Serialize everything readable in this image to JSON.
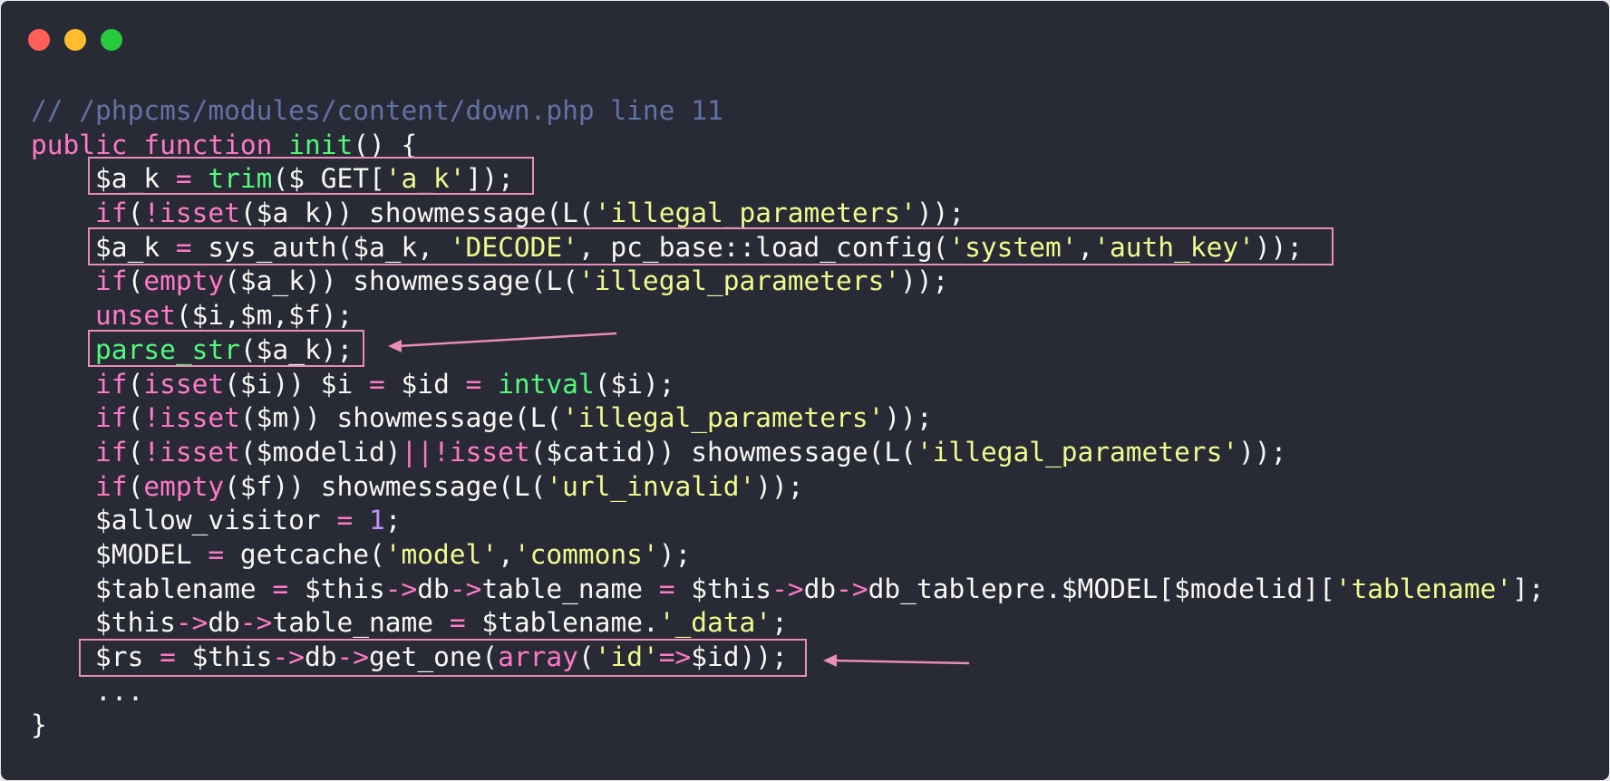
{
  "window": {
    "controls": [
      {
        "name": "close",
        "color": "#ff5f56"
      },
      {
        "name": "minimize",
        "color": "#ffbd2e"
      },
      {
        "name": "maximize",
        "color": "#27c93f"
      }
    ]
  },
  "highlight_color": "#e88db5",
  "code": {
    "lines": [
      [
        {
          "t": "// /phpcms/modules/content/down.php line 11",
          "c": "comment"
        }
      ],
      [
        {
          "t": "public",
          "c": "keyword"
        },
        {
          "t": " ",
          "c": "plain"
        },
        {
          "t": "function",
          "c": "keyword"
        },
        {
          "t": " ",
          "c": "plain"
        },
        {
          "t": "init",
          "c": "function"
        },
        {
          "t": "() {",
          "c": "plain"
        }
      ],
      [
        {
          "t": "    $a_k ",
          "c": "plain"
        },
        {
          "t": "=",
          "c": "operator"
        },
        {
          "t": " ",
          "c": "plain"
        },
        {
          "t": "trim",
          "c": "function"
        },
        {
          "t": "($_GET[",
          "c": "plain"
        },
        {
          "t": "'a_k'",
          "c": "string"
        },
        {
          "t": "]);",
          "c": "plain"
        }
      ],
      [
        {
          "t": "    ",
          "c": "plain"
        },
        {
          "t": "if",
          "c": "keyword"
        },
        {
          "t": "(",
          "c": "plain"
        },
        {
          "t": "!",
          "c": "operator"
        },
        {
          "t": "isset",
          "c": "keyword"
        },
        {
          "t": "($a_k)) showmessage(L(",
          "c": "plain"
        },
        {
          "t": "'illegal_parameters'",
          "c": "string"
        },
        {
          "t": "));",
          "c": "plain"
        }
      ],
      [
        {
          "t": "    $a_k ",
          "c": "plain"
        },
        {
          "t": "=",
          "c": "operator"
        },
        {
          "t": " sys_auth($a_k, ",
          "c": "plain"
        },
        {
          "t": "'DECODE'",
          "c": "string"
        },
        {
          "t": ", pc_base::load_config(",
          "c": "plain"
        },
        {
          "t": "'system'",
          "c": "string"
        },
        {
          "t": ",",
          "c": "plain"
        },
        {
          "t": "'auth_key'",
          "c": "string"
        },
        {
          "t": "));",
          "c": "plain"
        }
      ],
      [
        {
          "t": "    ",
          "c": "plain"
        },
        {
          "t": "if",
          "c": "keyword"
        },
        {
          "t": "(",
          "c": "plain"
        },
        {
          "t": "empty",
          "c": "keyword"
        },
        {
          "t": "($a_k)) showmessage(L(",
          "c": "plain"
        },
        {
          "t": "'illegal_parameters'",
          "c": "string"
        },
        {
          "t": "));",
          "c": "plain"
        }
      ],
      [
        {
          "t": "    ",
          "c": "plain"
        },
        {
          "t": "unset",
          "c": "keyword"
        },
        {
          "t": "($i,$m,$f);",
          "c": "plain"
        }
      ],
      [
        {
          "t": "    ",
          "c": "plain"
        },
        {
          "t": "parse_str",
          "c": "function"
        },
        {
          "t": "($a_k);",
          "c": "plain"
        }
      ],
      [
        {
          "t": "    ",
          "c": "plain"
        },
        {
          "t": "if",
          "c": "keyword"
        },
        {
          "t": "(",
          "c": "plain"
        },
        {
          "t": "isset",
          "c": "keyword"
        },
        {
          "t": "($i)) $i ",
          "c": "plain"
        },
        {
          "t": "=",
          "c": "operator"
        },
        {
          "t": " $id ",
          "c": "plain"
        },
        {
          "t": "=",
          "c": "operator"
        },
        {
          "t": " ",
          "c": "plain"
        },
        {
          "t": "intval",
          "c": "function"
        },
        {
          "t": "($i);",
          "c": "plain"
        }
      ],
      [
        {
          "t": "    ",
          "c": "plain"
        },
        {
          "t": "if",
          "c": "keyword"
        },
        {
          "t": "(",
          "c": "plain"
        },
        {
          "t": "!",
          "c": "operator"
        },
        {
          "t": "isset",
          "c": "keyword"
        },
        {
          "t": "($m)) showmessage(L(",
          "c": "plain"
        },
        {
          "t": "'illegal_parameters'",
          "c": "string"
        },
        {
          "t": "));",
          "c": "plain"
        }
      ],
      [
        {
          "t": "    ",
          "c": "plain"
        },
        {
          "t": "if",
          "c": "keyword"
        },
        {
          "t": "(",
          "c": "plain"
        },
        {
          "t": "!",
          "c": "operator"
        },
        {
          "t": "isset",
          "c": "keyword"
        },
        {
          "t": "($modelid)",
          "c": "plain"
        },
        {
          "t": "||!",
          "c": "operator"
        },
        {
          "t": "isset",
          "c": "keyword"
        },
        {
          "t": "($catid)) showmessage(L(",
          "c": "plain"
        },
        {
          "t": "'illegal_parameters'",
          "c": "string"
        },
        {
          "t": "));",
          "c": "plain"
        }
      ],
      [
        {
          "t": "    ",
          "c": "plain"
        },
        {
          "t": "if",
          "c": "keyword"
        },
        {
          "t": "(",
          "c": "plain"
        },
        {
          "t": "empty",
          "c": "keyword"
        },
        {
          "t": "($f)) showmessage(L(",
          "c": "plain"
        },
        {
          "t": "'url_invalid'",
          "c": "string"
        },
        {
          "t": "));",
          "c": "plain"
        }
      ],
      [
        {
          "t": "    $allow_visitor ",
          "c": "plain"
        },
        {
          "t": "=",
          "c": "operator"
        },
        {
          "t": " ",
          "c": "plain"
        },
        {
          "t": "1",
          "c": "number"
        },
        {
          "t": ";",
          "c": "plain"
        }
      ],
      [
        {
          "t": "    $MODEL ",
          "c": "plain"
        },
        {
          "t": "=",
          "c": "operator"
        },
        {
          "t": " getcache(",
          "c": "plain"
        },
        {
          "t": "'model'",
          "c": "string"
        },
        {
          "t": ",",
          "c": "plain"
        },
        {
          "t": "'commons'",
          "c": "string"
        },
        {
          "t": ");",
          "c": "plain"
        }
      ],
      [
        {
          "t": "    $tablename ",
          "c": "plain"
        },
        {
          "t": "=",
          "c": "operator"
        },
        {
          "t": " $this",
          "c": "plain"
        },
        {
          "t": "->",
          "c": "operator"
        },
        {
          "t": "db",
          "c": "plain"
        },
        {
          "t": "->",
          "c": "operator"
        },
        {
          "t": "table_name ",
          "c": "plain"
        },
        {
          "t": "=",
          "c": "operator"
        },
        {
          "t": " $this",
          "c": "plain"
        },
        {
          "t": "->",
          "c": "operator"
        },
        {
          "t": "db",
          "c": "plain"
        },
        {
          "t": "->",
          "c": "operator"
        },
        {
          "t": "db_tablepre.$MODEL[$modelid][",
          "c": "plain"
        },
        {
          "t": "'tablename'",
          "c": "string"
        },
        {
          "t": "];",
          "c": "plain"
        }
      ],
      [
        {
          "t": "    $this",
          "c": "plain"
        },
        {
          "t": "->",
          "c": "operator"
        },
        {
          "t": "db",
          "c": "plain"
        },
        {
          "t": "->",
          "c": "operator"
        },
        {
          "t": "table_name ",
          "c": "plain"
        },
        {
          "t": "=",
          "c": "operator"
        },
        {
          "t": " $tablename.",
          "c": "plain"
        },
        {
          "t": "'_data'",
          "c": "string"
        },
        {
          "t": ";",
          "c": "plain"
        }
      ],
      [
        {
          "t": "    $rs ",
          "c": "plain"
        },
        {
          "t": "=",
          "c": "operator"
        },
        {
          "t": " $this",
          "c": "plain"
        },
        {
          "t": "->",
          "c": "operator"
        },
        {
          "t": "db",
          "c": "plain"
        },
        {
          "t": "->",
          "c": "operator"
        },
        {
          "t": "get_one(",
          "c": "plain"
        },
        {
          "t": "array",
          "c": "keyword"
        },
        {
          "t": "(",
          "c": "plain"
        },
        {
          "t": "'id'",
          "c": "string"
        },
        {
          "t": "=>",
          "c": "operator"
        },
        {
          "t": "$id));",
          "c": "plain"
        }
      ],
      [
        {
          "t": "    ...",
          "c": "plain"
        }
      ],
      [
        {
          "t": "}",
          "c": "plain"
        }
      ]
    ]
  }
}
